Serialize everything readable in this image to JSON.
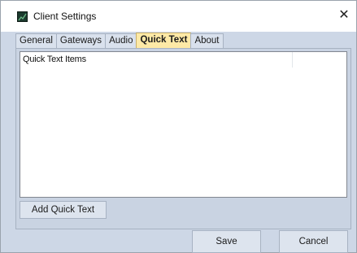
{
  "window": {
    "title": "Client Settings",
    "close_glyph": "✕",
    "icon": "app-icon"
  },
  "tabs": [
    {
      "label": "General",
      "active": false
    },
    {
      "label": "Gateways",
      "active": false
    },
    {
      "label": "Audio",
      "active": false
    },
    {
      "label": "Quick Text",
      "active": true
    },
    {
      "label": "About",
      "active": false
    }
  ],
  "quick_text": {
    "column_header": "Quick Text Items",
    "items": [],
    "add_label": "Add Quick Text"
  },
  "footer": {
    "save_label": "Save",
    "cancel_label": "Cancel"
  },
  "colors": {
    "active_tab": "#fde9a6",
    "window_background": "#cdd7e6"
  }
}
